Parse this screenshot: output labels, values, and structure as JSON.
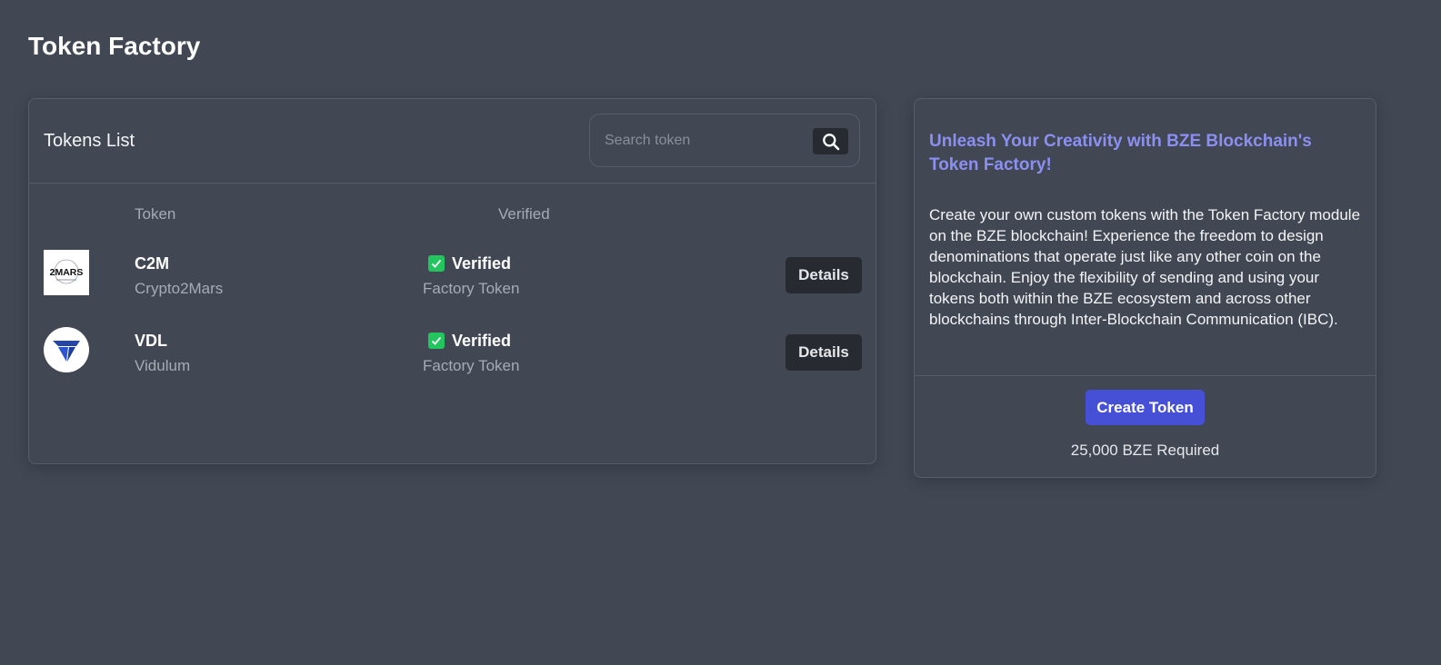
{
  "page": {
    "title": "Token Factory"
  },
  "tokens_list": {
    "title": "Tokens List",
    "search": {
      "placeholder": "Search token",
      "value": "",
      "icon": "search-icon"
    },
    "columns": [
      "Token",
      "Verified"
    ],
    "rows": [
      {
        "symbol": "C2M",
        "name": "Crypto2Mars",
        "logo": {
          "icon": "c2m-logo",
          "text": "2MARS"
        },
        "verified_label": "Verified",
        "type": "Factory Token",
        "action_label": "Details"
      },
      {
        "symbol": "VDL",
        "name": "Vidulum",
        "logo": {
          "icon": "vdl-logo"
        },
        "verified_label": "Verified",
        "type": "Factory Token",
        "action_label": "Details"
      }
    ]
  },
  "info_panel": {
    "heading": "Unleash Your Creativity with BZE Blockchain's Token Factory!",
    "body": "Create your own custom tokens with the Token Factory module on the BZE blockchain! Experience the freedom to design denominations that operate just like any other coin on the blockchain. Enjoy the flexibility of sending and using your tokens both within the BZE ecosystem and across other blockchains through Inter-Blockchain Communication (IBC).",
    "button_label": "Create Token",
    "requirement": "25,000 BZE Required"
  },
  "colors": {
    "background": "#414753",
    "accent": "#4650d6",
    "heading_accent": "#8b8ff0",
    "verified": "#22c55e",
    "button_dark": "#272a30"
  }
}
